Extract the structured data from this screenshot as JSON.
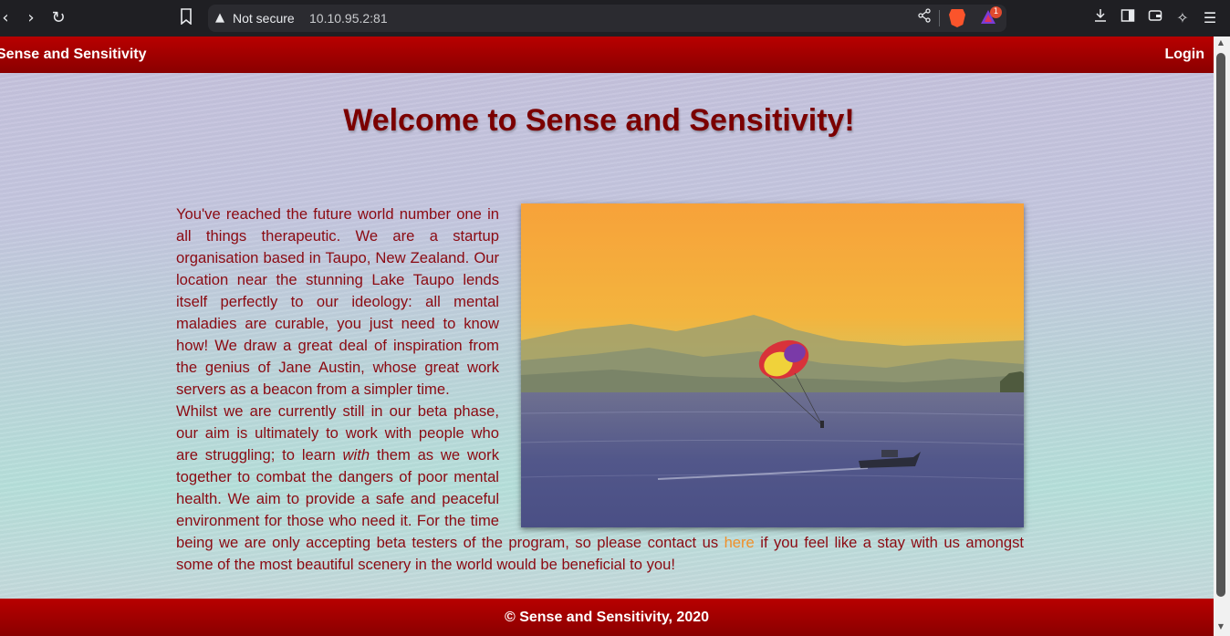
{
  "browser": {
    "security_label": "Not secure",
    "url": "10.10.95.2:81",
    "rewards_count": "1"
  },
  "site": {
    "brand": "Sense and Sensitivity",
    "login_label": "Login",
    "headline": "Welcome to Sense and Sensitivity!",
    "paragraph1": "You've reached the future world number one in all things therapeutic. We are a startup organisation based in Taupo, New Zealand. Our location near the stunning Lake Taupo lends itself perfectly to our ideology: all mental maladies are curable, you just need to know how! We draw a great deal of inspiration from the genius of Jane Austin, whose great work servers as a beacon from a simpler time.",
    "paragraph2_before": "Whilst we are currently still in our beta phase, our aim is ultimately to work with people who are struggling; to learn ",
    "paragraph2_emphasis": "with",
    "paragraph2_middle": " them as we work together to combat the dangers of poor mental health. We aim to provide a safe and peaceful environment for those who need it. For the time being we are only accepting beta testers of the program, so please contact us ",
    "contact_link": "here",
    "paragraph2_after": " if you feel like a stay with us amongst some of the most beautiful scenery in the world would be beneficial to you!",
    "footer": "© Sense and Sensitivity, 2020"
  },
  "colors": {
    "nav_red": "#b80000",
    "heading": "#7b0000",
    "body_text": "#8b0a12",
    "link": "#f0902a"
  },
  "icons": {
    "back": "chevron-left-icon",
    "forward": "chevron-right-icon",
    "reload": "reload-icon",
    "bookmark": "bookmark-icon",
    "warning": "warning-icon",
    "share": "share-icon",
    "brave": "brave-shield-icon",
    "rewards": "brave-rewards-icon",
    "download": "download-icon",
    "sidebar": "sidebar-icon",
    "wallet": "wallet-icon",
    "leo": "leo-ai-icon",
    "menu": "menu-icon"
  }
}
